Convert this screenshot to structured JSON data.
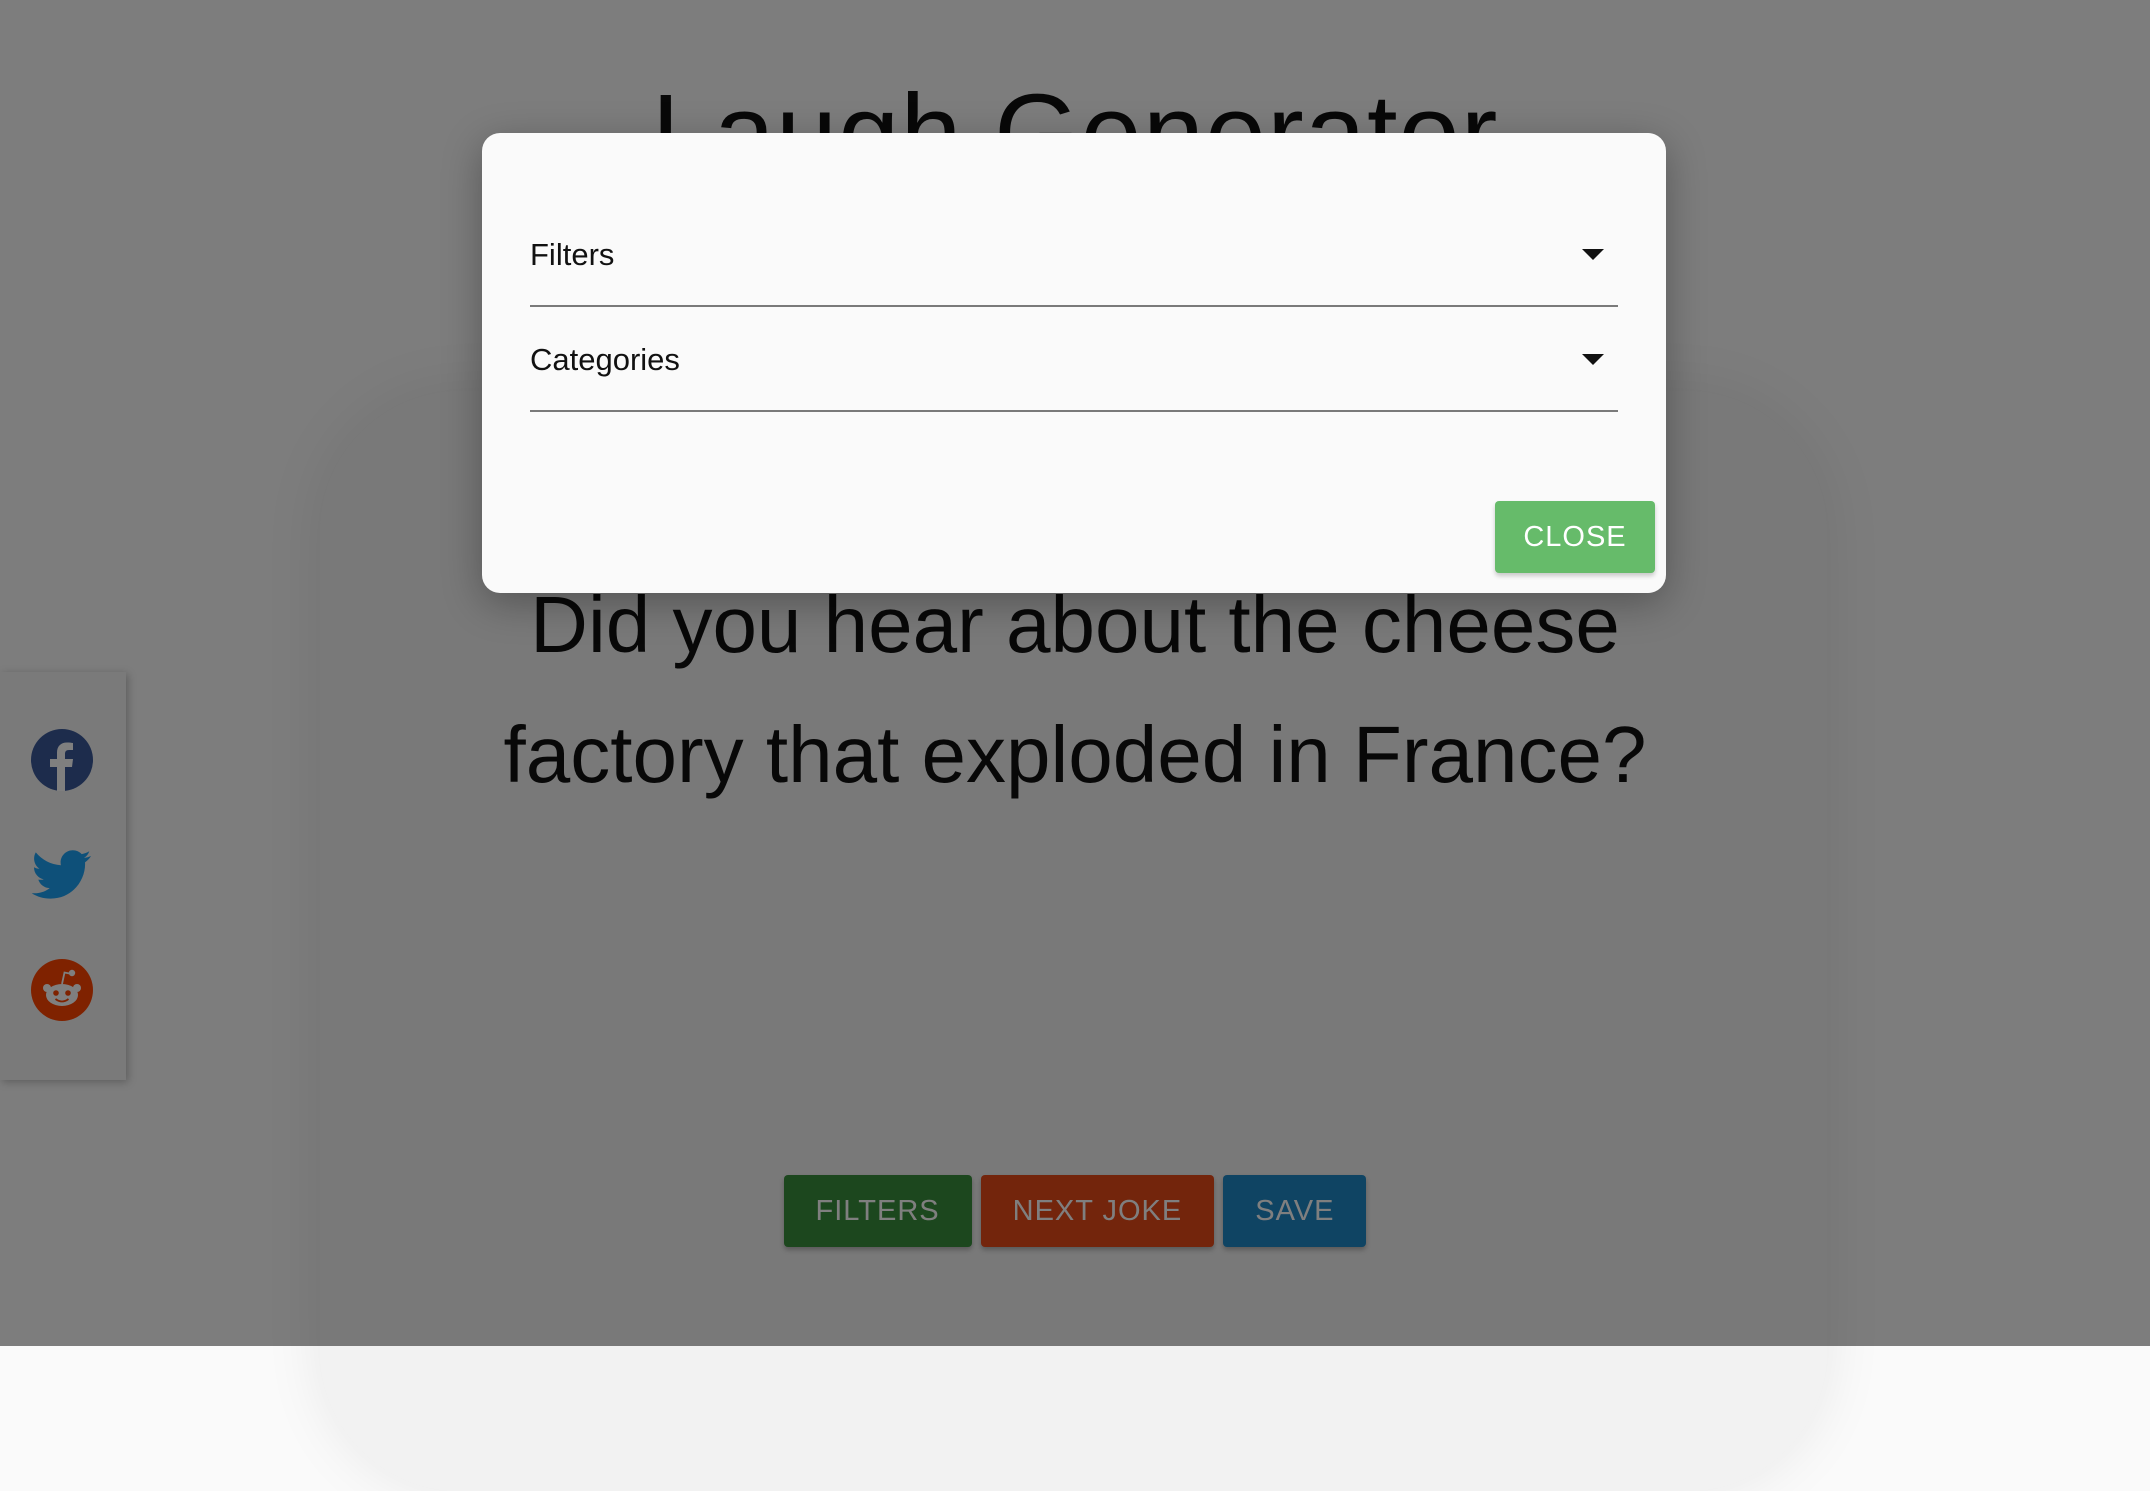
{
  "page": {
    "title": "Laugh Generator",
    "joke": "Did you hear about the cheese factory that exploded in France?"
  },
  "actions": {
    "filters_label": "FILTERS",
    "next_label": "NEXT JOKE",
    "save_label": "SAVE"
  },
  "social": {
    "items": [
      {
        "icon": "facebook-icon",
        "color": "#3b5998"
      },
      {
        "icon": "twitter-icon",
        "color": "#1da1f2"
      },
      {
        "icon": "reddit-icon",
        "color": "#ff4500"
      }
    ]
  },
  "dialog": {
    "filters_label": "Filters",
    "categories_label": "Categories",
    "close_label": "CLOSE"
  },
  "colors": {
    "filters_button": "#388e3c",
    "next_button": "#e64a19",
    "save_button": "#1e88c7",
    "close_button": "#66bb6a"
  }
}
